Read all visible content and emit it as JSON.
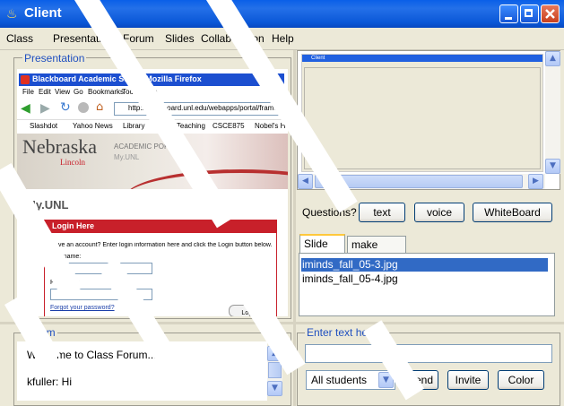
{
  "window": {
    "title": "Client"
  },
  "menu": [
    "Class",
    "Presentation",
    "Forum",
    "Slides",
    "Collaboration",
    "Help"
  ],
  "presentation": {
    "label": "Presentation",
    "browser_title": "Blackboard Academic Suite - Mozilla Firefox",
    "browser_menu": [
      "File",
      "Edit",
      "View",
      "Go",
      "Bookmarks",
      "Tools",
      "Help"
    ],
    "url": "http://blackboard.unl.edu/webapps/portal/frame",
    "bookmarks": [
      "Slashdot",
      "Yahoo News",
      "Library",
      "Sch Teaching",
      "CSCE875",
      "Nobel's Hon"
    ],
    "portal_logo": "Nebraska",
    "portal_logo_sub": "Lincoln",
    "portal_title": "ACADEMIC PORTAL",
    "portal_sub": "My.UNL",
    "page_heading": "My.UNL",
    "login_header": "Login Here",
    "login_text": "Have an account? Enter login information here and click the Login button below.",
    "username_label": "Username:",
    "password_label": "Password:",
    "forgot_link": "Forgot your password?",
    "login_button": "Login"
  },
  "preview": {
    "title": "Client"
  },
  "questions": {
    "label": "Questions?",
    "text_button": "text",
    "voice_button": "voice",
    "whiteboard_button": "WhiteBoard"
  },
  "slides": {
    "tabs": [
      "Slide list",
      "make notes"
    ],
    "items": [
      "iminds_fall_05-3.jpg",
      "iminds_fall_05-4.jpg"
    ]
  },
  "forum": {
    "label": "Forum",
    "messages": [
      {
        "text": "Welcome to Class Forum..."
      },
      {
        "text": "kfuller:  Hi"
      }
    ]
  },
  "chat": {
    "label": "Enter text here",
    "input_value": "",
    "recipient": "All students",
    "send_button": "Send",
    "invite_button": "Invite",
    "color_button": "Color"
  },
  "colors": {
    "title_bar": "#0A5FE8",
    "selection": "#316AC5",
    "group_label": "#2050C0",
    "portal_red": "#C8202A"
  }
}
